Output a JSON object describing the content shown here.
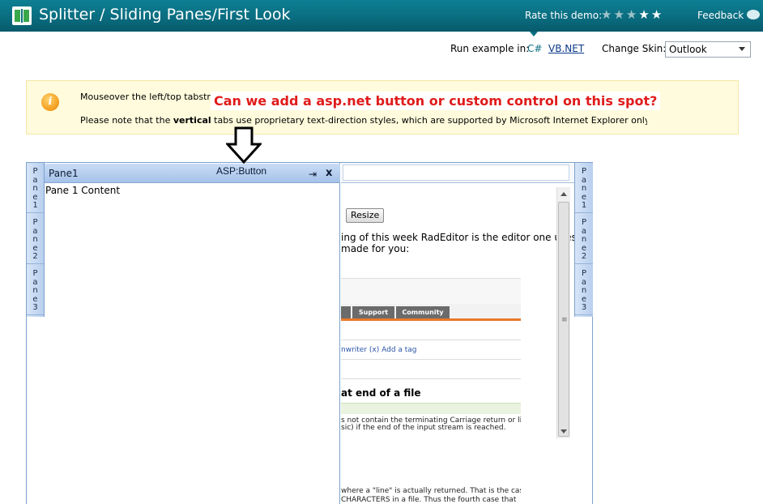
{
  "header": {
    "title": "Splitter / Sliding Panes/First Look",
    "rate_label": "Rate this demo:",
    "rating": {
      "filled": 2,
      "total": 5
    },
    "feedback_label": "Feedback"
  },
  "run_bar": {
    "run_label": "Run example in:",
    "lang_cs": "C#",
    "lang_vb": "VB.NET",
    "skin_label": "Change Skin:",
    "skin_value": "Outlook"
  },
  "info": {
    "line1": "Mouseover the left/top tabstrip",
    "line2_pre": "Please note that the ",
    "line2_bold": "vertical",
    "line2_post": " tabs use proprietary text-direction styles, which are supported by Microsoft Internet Explorer only."
  },
  "annotation": {
    "text": "Can we add a asp.net button or custom control on this spot?"
  },
  "splitter": {
    "left_tabs": [
      "Pane1",
      "Pane2",
      "Pane3"
    ],
    "right_tabs": [
      "Pane1",
      "Pane2",
      "Pane3"
    ],
    "pane1": {
      "title": "Pane1",
      "button_label": "ASP:Button",
      "pin_icon": "⇥",
      "close_icon": "x",
      "content": "Pane 1 Content"
    }
  },
  "background_content": {
    "resize_label": "Resize",
    "text1": "ing of this week RadEditor is the editor one uses",
    "text2": "made for you:",
    "editor_shot": {
      "tabs": [
        "Support",
        "Community"
      ],
      "links": "nwriter (x)   Add a tag",
      "heading": "at end of a file",
      "lines": [
        "s not contain the terminating Carriage return or li",
        "sic) if the end of the input stream is reached.",
        "where a \"line\" is actually returned. That is the cas",
        "CHARACTERS in a file. Thus the fourth case that"
      ]
    }
  },
  "colors": {
    "header_bg": "#0a6d80",
    "annotation_text": "#e01b1b",
    "info_bg": "#fffbdc",
    "pane_header": "#a6c2ea"
  }
}
